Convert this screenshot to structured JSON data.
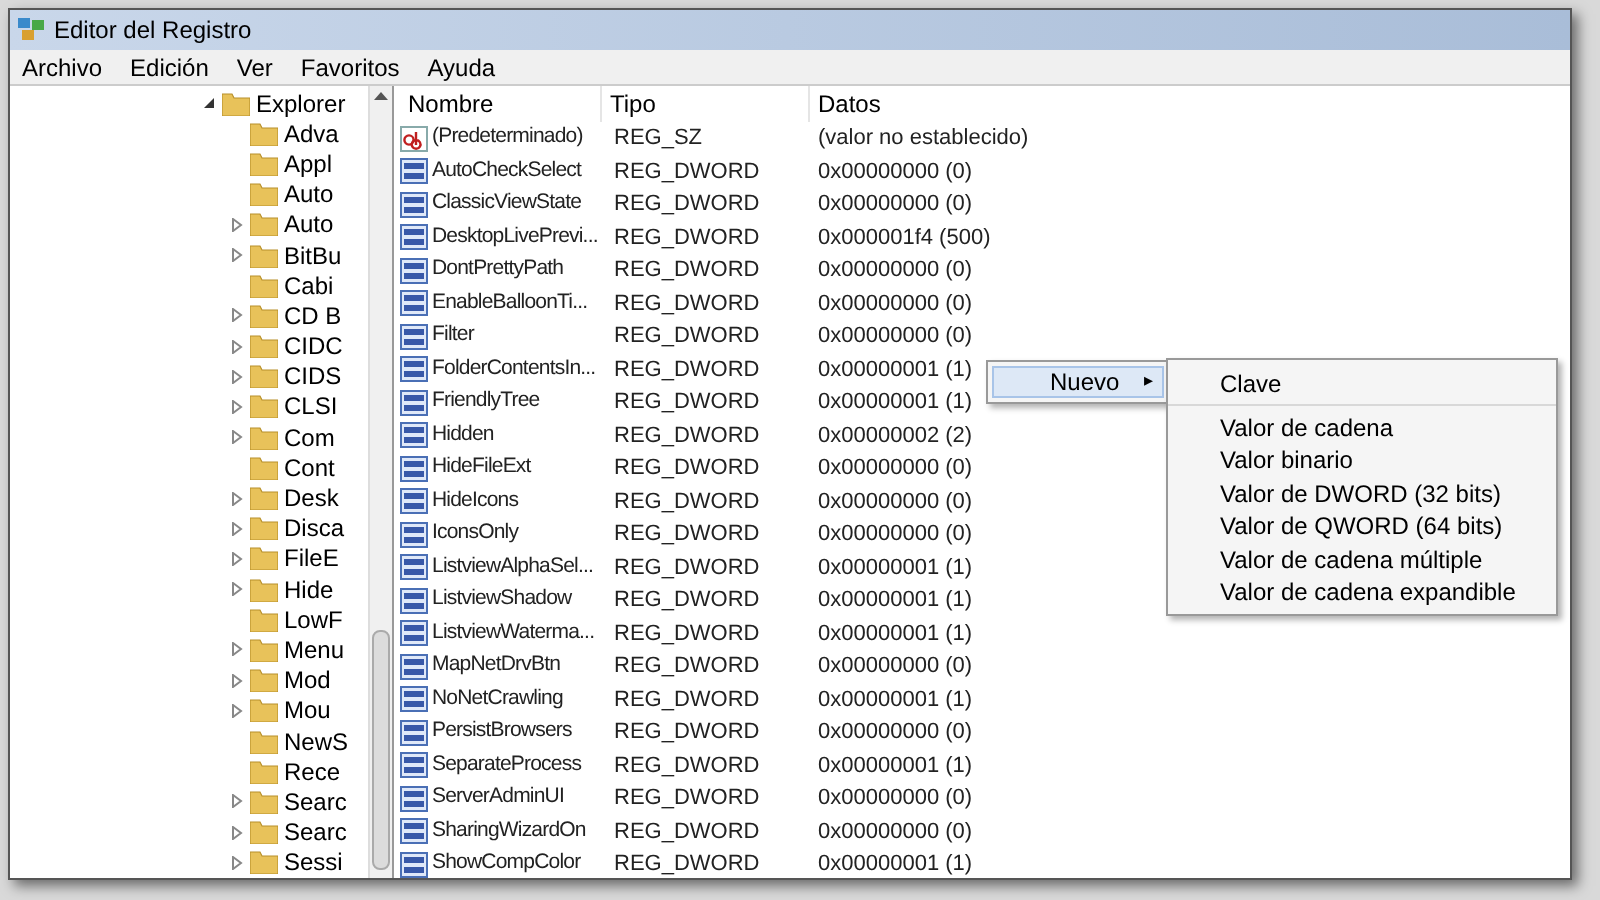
{
  "window": {
    "title": "Editor del Registro"
  },
  "menu_bar": [
    "Archivo",
    "Edición",
    "Ver",
    "Favoritos",
    "Ayuda"
  ],
  "tree": {
    "items": [
      {
        "label": "Explorer",
        "expanded": true,
        "children": [
          {
            "label": "Adva",
            "has_children": false
          },
          {
            "label": "Appl",
            "has_children": false
          },
          {
            "label": "Auto",
            "has_children": false
          },
          {
            "label": "Auto",
            "has_children": true
          },
          {
            "label": "BitBu",
            "has_children": true
          },
          {
            "label": "Cabi",
            "has_children": false
          },
          {
            "label": "CD B",
            "has_children": true
          },
          {
            "label": "CIDC",
            "has_children": true
          },
          {
            "label": "CIDS",
            "has_children": true
          },
          {
            "label": "CLSI",
            "has_children": true
          },
          {
            "label": "Com",
            "has_children": true
          },
          {
            "label": "Cont",
            "has_children": false
          },
          {
            "label": "Desk",
            "has_children": true
          },
          {
            "label": "Disca",
            "has_children": true
          },
          {
            "label": "FileE",
            "has_children": true
          },
          {
            "label": "Hide",
            "has_children": true
          },
          {
            "label": "LowF",
            "has_children": false
          },
          {
            "label": "Menu",
            "has_children": true
          },
          {
            "label": "Mod",
            "has_children": true
          },
          {
            "label": "Mou",
            "has_children": true
          },
          {
            "label": "NewS",
            "has_children": false
          },
          {
            "label": "Rece",
            "has_children": false
          },
          {
            "label": "Searc",
            "has_children": true
          },
          {
            "label": "Searc",
            "has_children": true
          },
          {
            "label": "Sessi",
            "has_children": true
          }
        ]
      }
    ]
  },
  "table": {
    "columns": [
      "Nombre",
      "Tipo",
      "Datos"
    ],
    "rows": [
      {
        "kind": "string",
        "name": "(Predeterminado)",
        "type": "REG_SZ",
        "data": "(valor no establecido)"
      },
      {
        "kind": "binary",
        "name": "AutoCheckSelect",
        "type": "REG_DWORD",
        "data": "0x00000000 (0)"
      },
      {
        "kind": "binary",
        "name": "ClassicViewState",
        "type": "REG_DWORD",
        "data": "0x00000000 (0)"
      },
      {
        "kind": "binary",
        "name": "DesktopLivePrevi...",
        "type": "REG_DWORD",
        "data": "0x000001f4 (500)"
      },
      {
        "kind": "binary",
        "name": "DontPrettyPath",
        "type": "REG_DWORD",
        "data": "0x00000000 (0)"
      },
      {
        "kind": "binary",
        "name": "EnableBalloonTi...",
        "type": "REG_DWORD",
        "data": "0x00000000 (0)"
      },
      {
        "kind": "binary",
        "name": "Filter",
        "type": "REG_DWORD",
        "data": "0x00000000 (0)"
      },
      {
        "kind": "binary",
        "name": "FolderContentsIn...",
        "type": "REG_DWORD",
        "data": "0x00000001 (1)"
      },
      {
        "kind": "binary",
        "name": "FriendlyTree",
        "type": "REG_DWORD",
        "data": "0x00000001 (1)"
      },
      {
        "kind": "binary",
        "name": "Hidden",
        "type": "REG_DWORD",
        "data": "0x00000002 (2)"
      },
      {
        "kind": "binary",
        "name": "HideFileExt",
        "type": "REG_DWORD",
        "data": "0x00000000 (0)"
      },
      {
        "kind": "binary",
        "name": "HideIcons",
        "type": "REG_DWORD",
        "data": "0x00000000 (0)"
      },
      {
        "kind": "binary",
        "name": "IconsOnly",
        "type": "REG_DWORD",
        "data": "0x00000000 (0)"
      },
      {
        "kind": "binary",
        "name": "ListviewAlphaSel...",
        "type": "REG_DWORD",
        "data": "0x00000001 (1)"
      },
      {
        "kind": "binary",
        "name": "ListviewShadow",
        "type": "REG_DWORD",
        "data": "0x00000001 (1)"
      },
      {
        "kind": "binary",
        "name": "ListviewWaterma...",
        "type": "REG_DWORD",
        "data": "0x00000001 (1)"
      },
      {
        "kind": "binary",
        "name": "MapNetDrvBtn",
        "type": "REG_DWORD",
        "data": "0x00000000 (0)"
      },
      {
        "kind": "binary",
        "name": "NoNetCrawling",
        "type": "REG_DWORD",
        "data": "0x00000001 (1)"
      },
      {
        "kind": "binary",
        "name": "PersistBrowsers",
        "type": "REG_DWORD",
        "data": "0x00000000 (0)"
      },
      {
        "kind": "binary",
        "name": "SeparateProcess",
        "type": "REG_DWORD",
        "data": "0x00000001 (1)"
      },
      {
        "kind": "binary",
        "name": "ServerAdminUI",
        "type": "REG_DWORD",
        "data": "0x00000000 (0)"
      },
      {
        "kind": "binary",
        "name": "SharingWizardOn",
        "type": "REG_DWORD",
        "data": "0x00000000 (0)"
      },
      {
        "kind": "binary",
        "name": "ShowCompColor",
        "type": "REG_DWORD",
        "data": "0x00000001 (1)"
      }
    ]
  },
  "context_menu": {
    "items": [
      {
        "label": "Nuevo",
        "selected": true,
        "arrow": "▸"
      }
    ]
  },
  "submenu": {
    "items": [
      {
        "label": "Clave",
        "separator_after": true
      },
      {
        "label": "Valor de cadena",
        "separator_after": false
      },
      {
        "label": "Valor binario",
        "separator_after": false
      },
      {
        "label": "Valor de DWORD (32 bits)",
        "separator_after": false
      },
      {
        "label": "Valor de QWORD (64 bits)",
        "separator_after": false
      },
      {
        "label": "Valor de cadena múltiple",
        "separator_after": false
      },
      {
        "label": "Valor de cadena expandible",
        "separator_after": false
      }
    ]
  }
}
